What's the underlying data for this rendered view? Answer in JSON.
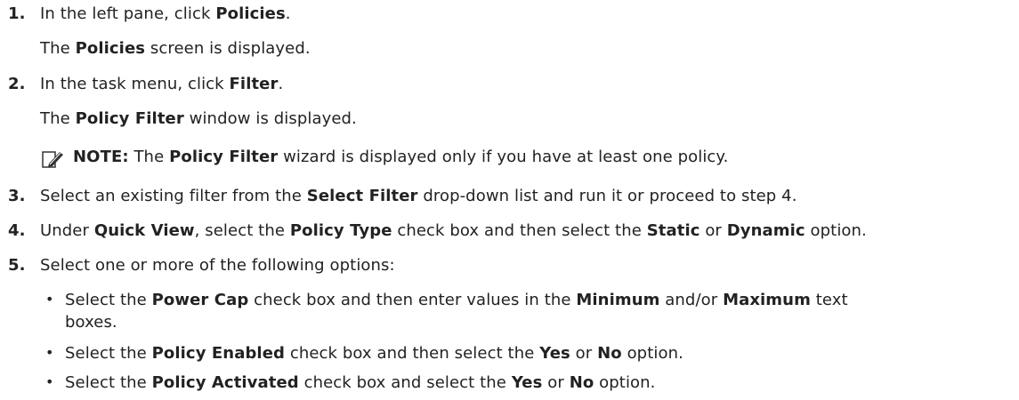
{
  "steps": [
    {
      "n": "1.",
      "parts": [
        "In the left pane, click ",
        "Policies",
        "."
      ]
    },
    {
      "sub1": [
        "The ",
        "Policies",
        " screen is displayed."
      ]
    },
    {
      "n": "2.",
      "parts": [
        "In the task menu, click ",
        "Filter",
        "."
      ]
    },
    {
      "sub2": [
        "The ",
        "Policy Filter",
        " window is displayed."
      ]
    }
  ],
  "note": {
    "label": "NOTE:",
    "parts": [
      " The ",
      "Policy Filter",
      " wizard is displayed only if you have at least one policy."
    ]
  },
  "step3": {
    "n": "3.",
    "parts": [
      "Select an existing filter from the ",
      "Select Filter",
      " drop-down list and run it or proceed to step 4."
    ]
  },
  "step4": {
    "n": "4.",
    "parts": [
      "Under ",
      "Quick View",
      ", select the ",
      "Policy Type",
      " check box and then select the ",
      "Static",
      " or ",
      "Dynamic",
      " option."
    ]
  },
  "step5": {
    "n": "5.",
    "parts": [
      "Select one or more of the following options:"
    ]
  },
  "bullets": [
    {
      "mark": "•",
      "parts": [
        "Select the ",
        "Power Cap",
        " check box and then enter values in the ",
        "Minimum",
        " and/or ",
        "Maximum",
        " text"
      ],
      "cont": "boxes."
    },
    {
      "mark": "•",
      "parts": [
        "Select the ",
        "Policy Enabled",
        " check box and then select the ",
        "Yes",
        " or ",
        "No",
        " option."
      ]
    },
    {
      "mark": "•",
      "parts": [
        "Select the ",
        "Policy Activated",
        " check box and select the ",
        "Yes",
        " or ",
        "No",
        " option."
      ]
    }
  ]
}
